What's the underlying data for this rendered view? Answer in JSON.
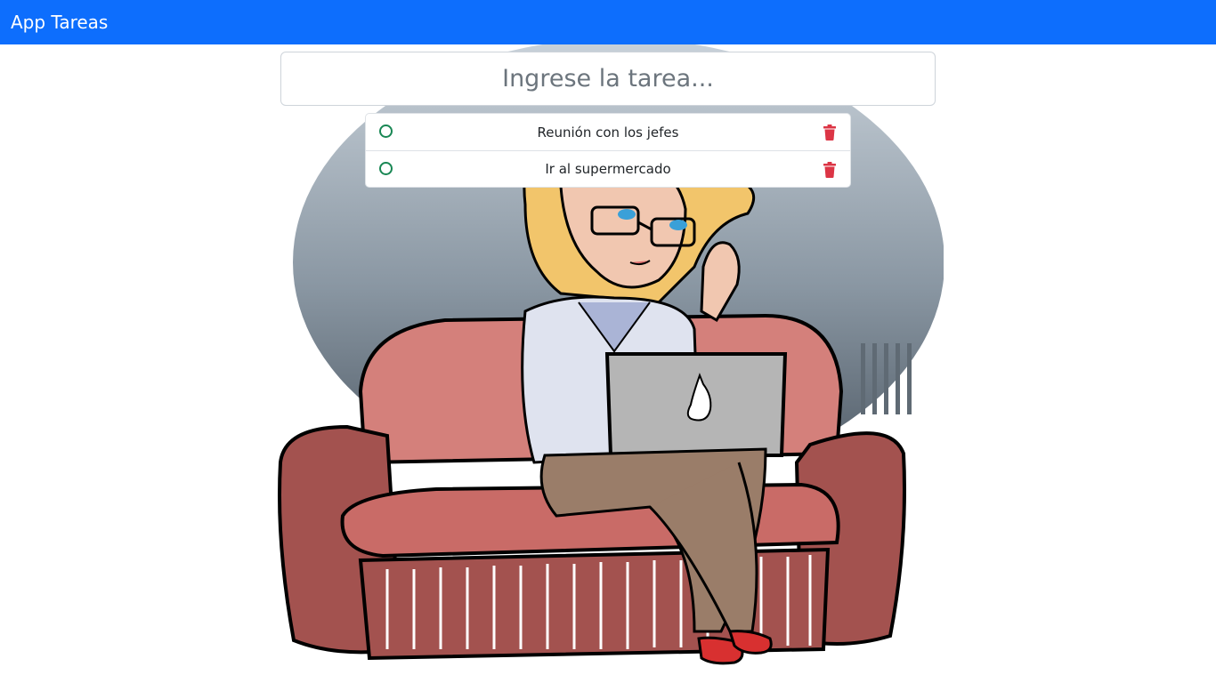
{
  "navbar": {
    "brand": "App Tareas",
    "color": "#0d6efd"
  },
  "task_input": {
    "value": "",
    "placeholder": "Ingrese la tarea..."
  },
  "tasks": [
    {
      "text": "Reunión con los jefes",
      "done": false,
      "check_icon": "circle-outline-icon",
      "delete_icon": "trash-icon"
    },
    {
      "text": "Ir al supermercado",
      "done": false,
      "check_icon": "circle-outline-icon",
      "delete_icon": "trash-icon"
    }
  ],
  "colors": {
    "check": "#198754",
    "delete": "#dc3545"
  }
}
